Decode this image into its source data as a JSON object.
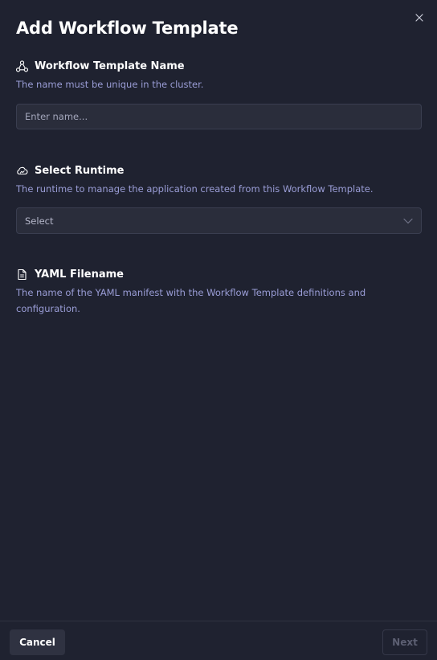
{
  "dialog": {
    "title": "Add Workflow Template",
    "close_icon": "close-icon"
  },
  "template_name": {
    "icon": "workflow-icon",
    "title": "Workflow Template Name",
    "description": "The name must be unique in the cluster.",
    "input_value": "",
    "input_placeholder": "Enter name..."
  },
  "runtime": {
    "icon": "cloud-icon",
    "title": "Select Runtime",
    "description": "The runtime to manage the application created from this Workflow Template.",
    "select_value": "Select",
    "chevron_icon": "chevron-down-icon"
  },
  "yaml": {
    "icon": "file-icon",
    "title": "YAML Filename",
    "description": "The name of the YAML manifest with the Workflow Template definitions and configuration."
  },
  "footer": {
    "cancel_label": "Cancel",
    "next_label": "Next"
  },
  "colors": {
    "background": "#1f2230",
    "input_bg": "#2a2d3b",
    "description_text": "#9a9dd6",
    "disabled_text": "#5c5f72"
  }
}
